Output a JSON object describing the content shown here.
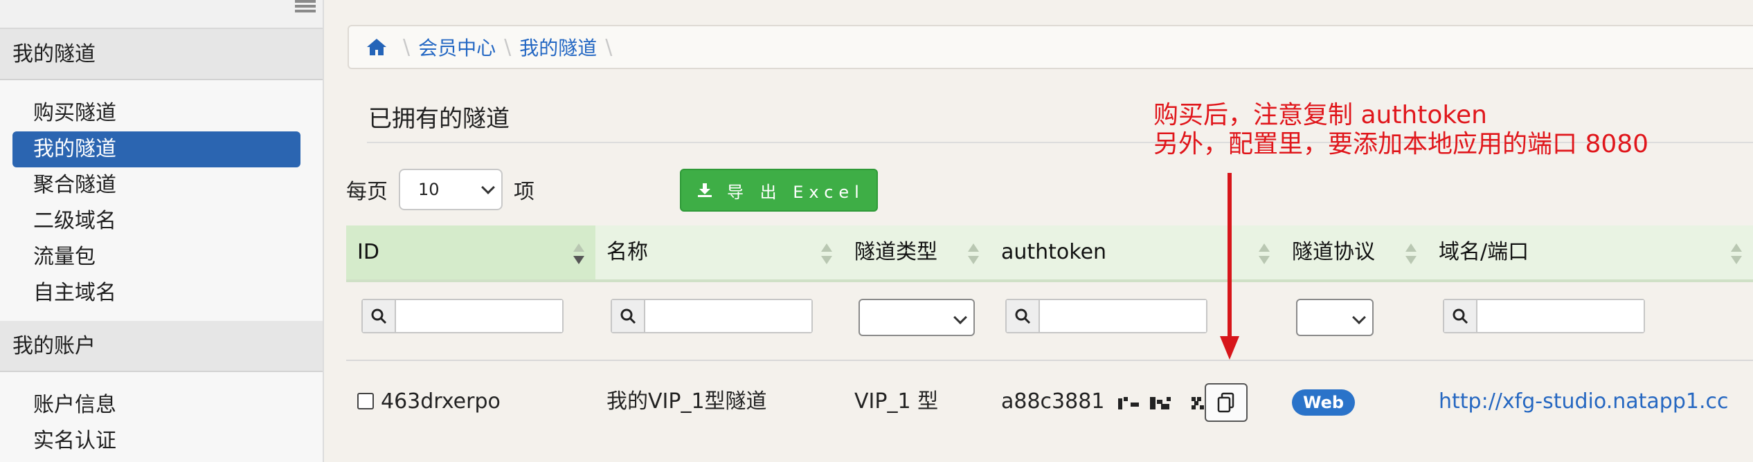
{
  "sidebar": {
    "section1": "我的隧道",
    "items1": [
      "购买隧道",
      "我的隧道",
      "聚合隧道",
      "二级域名",
      "流量包",
      "自主域名"
    ],
    "section2": "我的账户",
    "items2": [
      "账户信息",
      "实名认证"
    ]
  },
  "breadcrumb": [
    "会员中心",
    "我的隧道"
  ],
  "page_title": "已拥有的隧道",
  "annotation": {
    "line1": "购买后，注意复制 authtoken",
    "line2": "另外，配置里，要添加本地应用的端口 8080"
  },
  "controls": {
    "perpage_prefix": "每页",
    "perpage_value": "10",
    "perpage_suffix": "项",
    "export_label": "导 出 Excel"
  },
  "table": {
    "headers": [
      "ID",
      "名称",
      "隧道类型",
      "authtoken",
      "隧道协议",
      "域名/端口"
    ],
    "rows": [
      {
        "id": "463drxerpo",
        "name": "我的VIP_1型隧道",
        "type": "VIP_1 型",
        "authtoken": "a88c3881",
        "protocol": "Web",
        "domain": "http://xfg-studio.natapp1.cc"
      }
    ]
  },
  "colors": {
    "accent": "#2b65b1",
    "export_green": "#3eae46",
    "annotation_red": "#e0161b",
    "header_green": "#e9f3e3"
  },
  "icons": [
    "home-icon",
    "download-icon",
    "search-icon",
    "copy-icon",
    "sort-icon",
    "chevron-down-icon"
  ]
}
